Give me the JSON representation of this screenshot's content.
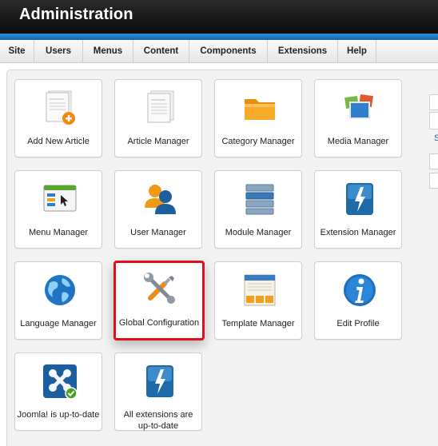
{
  "header": {
    "title": "Administration"
  },
  "menu": [
    "Site",
    "Users",
    "Menus",
    "Content",
    "Components",
    "Extensions",
    "Help"
  ],
  "tiles": [
    {
      "label": "Add New Article",
      "icon": "add-article-icon"
    },
    {
      "label": "Article Manager",
      "icon": "article-manager-icon"
    },
    {
      "label": "Category Manager",
      "icon": "folder-icon"
    },
    {
      "label": "Media Manager",
      "icon": "media-icon"
    },
    {
      "label": "Menu Manager",
      "icon": "menu-manager-icon"
    },
    {
      "label": "User Manager",
      "icon": "users-icon"
    },
    {
      "label": "Module Manager",
      "icon": "module-icon"
    },
    {
      "label": "Extension Manager",
      "icon": "extension-bolt-icon"
    },
    {
      "label": "Language Manager",
      "icon": "globe-icon"
    },
    {
      "label": "Global Configuration",
      "icon": "wrench-screwdriver-icon"
    },
    {
      "label": "Template Manager",
      "icon": "template-icon"
    },
    {
      "label": "Edit Profile",
      "icon": "info-icon"
    },
    {
      "label": "Joomla! is up-to-date",
      "icon": "joomla-check-icon"
    },
    {
      "label": "All extensions are up-to-date",
      "icon": "extension-bolt-icon"
    }
  ],
  "sidebar": {
    "partial_text": "S"
  },
  "colors": {
    "selected_border": "#e0101a",
    "header_bg": "#111111",
    "accent_blue": "#1a72c0"
  }
}
